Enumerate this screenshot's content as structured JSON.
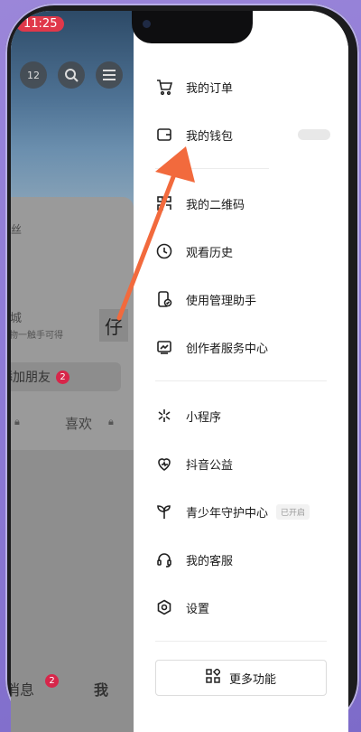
{
  "status": {
    "time": "11:25"
  },
  "profile": {
    "notice_count": "12",
    "fans_fragment": "丝",
    "mall_fragment": "商城",
    "mall_sub": "好物一触手可得",
    "add_friend": "添加朋友",
    "add_friend_badge": "2",
    "likes_tab": "喜欢",
    "partial_icon_text": "仔",
    "nav_messages": "消息",
    "nav_messages_badge": "2",
    "nav_me": "我"
  },
  "drawer": {
    "items": [
      {
        "label": "我的订单",
        "icon": "cart-icon"
      },
      {
        "label": "我的钱包",
        "icon": "wallet-icon"
      },
      {
        "label": "我的二维码",
        "icon": "qrcode-icon"
      },
      {
        "label": "观看历史",
        "icon": "clock-icon"
      },
      {
        "label": "使用管理助手",
        "icon": "phone-check-icon"
      },
      {
        "label": "创作者服务中心",
        "icon": "chart-icon"
      },
      {
        "label": "小程序",
        "icon": "asterisk-icon"
      },
      {
        "label": "抖音公益",
        "icon": "heart-icon"
      },
      {
        "label": "青少年守护中心",
        "icon": "sprout-icon",
        "status": "已开启"
      },
      {
        "label": "我的客服",
        "icon": "headset-icon"
      },
      {
        "label": "设置",
        "icon": "hexagon-gear-icon"
      }
    ],
    "more_label": "更多功能"
  },
  "accent": "#f26a3d"
}
